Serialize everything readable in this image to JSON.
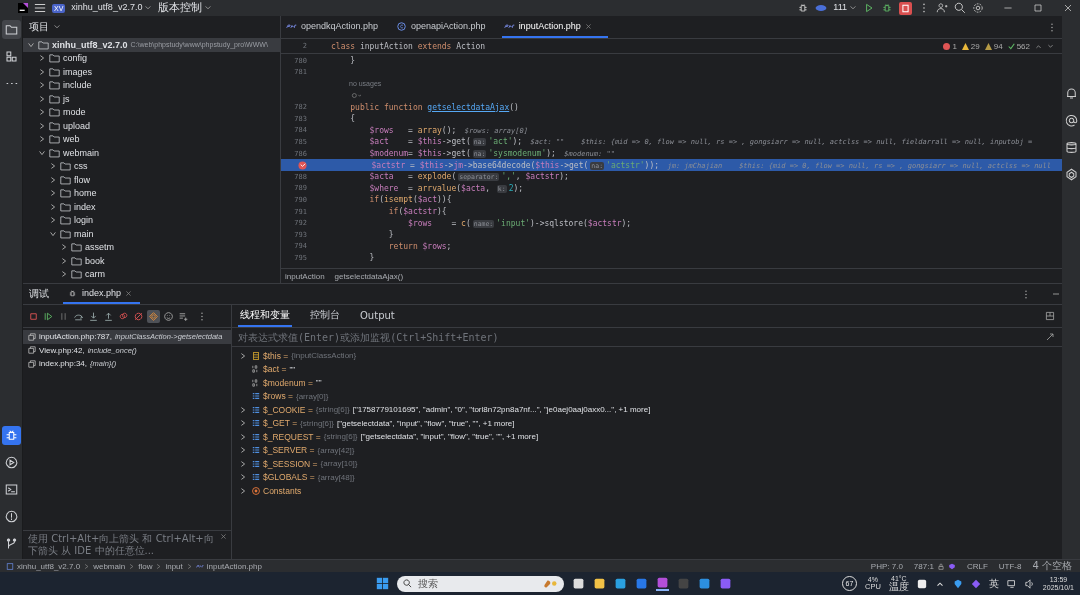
{
  "title_bar": {
    "project_badge": "XV",
    "project": "xinhu_utf8_v2.7.0",
    "vcs": "版本控制",
    "run_config": "111"
  },
  "left_strip": {
    "top": [
      {
        "kind": "folder",
        "selected": true
      },
      {
        "kind": "structure",
        "selected": false
      },
      {
        "kind": "more",
        "selected": false
      }
    ],
    "bottom": [
      {
        "kind": "debug",
        "selected": true
      },
      {
        "kind": "services",
        "selected": false
      },
      {
        "kind": "terminal",
        "selected": false
      },
      {
        "kind": "problems",
        "selected": false
      },
      {
        "kind": "git",
        "selected": false
      }
    ]
  },
  "project_panel": {
    "title": "项目",
    "tree": [
      {
        "name": "xinhu_utf8_v2.7.0",
        "path": "C:\\web\\phpstudy\\www\\phpstudy_pro\\WWW\\",
        "expanded": true,
        "selected": true,
        "children": [
          {
            "name": "config",
            "expanded": false,
            "selected": false
          },
          {
            "name": "images",
            "expanded": false,
            "selected": false
          },
          {
            "name": "include",
            "expanded": false,
            "selected": false
          },
          {
            "name": "js",
            "expanded": false,
            "selected": false
          },
          {
            "name": "mode",
            "expanded": false,
            "selected": false
          },
          {
            "name": "upload",
            "expanded": false,
            "selected": false
          },
          {
            "name": "web",
            "expanded": false,
            "selected": false
          },
          {
            "name": "webmain",
            "expanded": true,
            "selected": false,
            "children": [
              {
                "name": "css",
                "expanded": false,
                "selected": false
              },
              {
                "name": "flow",
                "expanded": false,
                "selected": false
              },
              {
                "name": "home",
                "expanded": false,
                "selected": false
              },
              {
                "name": "index",
                "expanded": false,
                "selected": false
              },
              {
                "name": "login",
                "expanded": false,
                "selected": false
              },
              {
                "name": "main",
                "expanded": true,
                "selected": false,
                "children": [
                  {
                    "name": "assetm",
                    "expanded": false,
                    "selected": false
                  },
                  {
                    "name": "book",
                    "expanded": false,
                    "selected": false
                  },
                  {
                    "name": "carm",
                    "expanded": false,
                    "selected": false
                  }
                ]
              }
            ]
          }
        ]
      }
    ]
  },
  "editor": {
    "tabs": [
      {
        "label": "opendkqAction.php",
        "kind": "php",
        "selected": false
      },
      {
        "label": "openapiAction.php",
        "kind": "class",
        "selected": false
      },
      {
        "label": "inputAction.php",
        "kind": "php",
        "selected": true
      }
    ],
    "inspections": {
      "errors": "1",
      "weak_warnings": "29",
      "warnings": "94",
      "ok": "562"
    },
    "sticky_line": {
      "number": "2",
      "segments": [
        {
          "kind": "kw",
          "text": "class"
        },
        {
          "kind": "plain",
          "text": " inputAction "
        },
        {
          "kind": "kw",
          "text": "extends"
        },
        {
          "kind": "plain",
          "text": " Action"
        }
      ]
    },
    "lines": [
      {
        "kind": "code",
        "number": "780",
        "breakpoint": false,
        "current": false,
        "segments": [
          {
            "kind": "plain",
            "text": "    }"
          }
        ]
      },
      {
        "kind": "code",
        "number": "781",
        "breakpoint": false,
        "current": false
      },
      {
        "kind": "lens",
        "text": "no usages"
      },
      {
        "kind": "code",
        "number": "782",
        "breakpoint": false,
        "current": false,
        "segments": [
          {
            "kind": "kw",
            "text": "    public "
          },
          {
            "kind": "kw",
            "text": "function "
          },
          {
            "kind": "fn",
            "text": "getselectdataAjax"
          },
          {
            "kind": "plain",
            "text": "()"
          }
        ]
      },
      {
        "kind": "code",
        "number": "783",
        "breakpoint": false,
        "current": false,
        "segments": [
          {
            "kind": "plain",
            "text": "    {"
          }
        ]
      },
      {
        "kind": "code",
        "number": "784",
        "breakpoint": false,
        "current": false,
        "segments": [
          {
            "kind": "var",
            "text": "        $rows"
          },
          {
            "kind": "plain",
            "text": "   = "
          },
          {
            "kind": "builtin",
            "text": "array"
          },
          {
            "kind": "plain",
            "text": "();"
          },
          {
            "kind": "hint",
            "text": "  $rows: array[0]"
          }
        ]
      },
      {
        "kind": "code",
        "number": "785",
        "breakpoint": false,
        "current": false,
        "segments": [
          {
            "kind": "var",
            "text": "        $act"
          },
          {
            "kind": "plain",
            "text": "    = "
          },
          {
            "kind": "var",
            "text": "$this"
          },
          {
            "kind": "plain",
            "text": "->get("
          },
          {
            "kind": "inlay",
            "text": "na:"
          },
          {
            "kind": "str",
            "text": "'act'"
          },
          {
            "kind": "plain",
            "text": ");"
          },
          {
            "kind": "hint",
            "text": "  $act: \"\"    $this: {mid => 0, flow => null, rs => , gongsiarr => null, actclss => null, fieldarrall => null, inputobj ="
          }
        ]
      },
      {
        "kind": "code",
        "number": "786",
        "breakpoint": false,
        "current": false,
        "segments": [
          {
            "kind": "var",
            "text": "        $modenum"
          },
          {
            "kind": "plain",
            "text": "= "
          },
          {
            "kind": "var",
            "text": "$this"
          },
          {
            "kind": "plain",
            "text": "->get("
          },
          {
            "kind": "inlay",
            "text": "na:"
          },
          {
            "kind": "str",
            "text": "'sysmodenum'"
          },
          {
            "kind": "plain",
            "text": ");"
          },
          {
            "kind": "hint",
            "text": "  $modenum: \"\""
          }
        ]
      },
      {
        "kind": "code",
        "breakpoint": true,
        "current": true,
        "segments": [
          {
            "kind": "var",
            "text": "        $actstr"
          },
          {
            "kind": "plain",
            "text": " = "
          },
          {
            "kind": "var",
            "text": "$this"
          },
          {
            "kind": "plain",
            "text": "->"
          },
          {
            "kind": "var",
            "text": "jm"
          },
          {
            "kind": "plain",
            "text": "->base64decode("
          },
          {
            "kind": "var",
            "text": "$this"
          },
          {
            "kind": "plain",
            "text": "->get("
          },
          {
            "kind": "inlay",
            "text": "na:"
          },
          {
            "kind": "str",
            "text": "'actstr'"
          },
          {
            "kind": "plain",
            "text": "));"
          },
          {
            "kind": "hint",
            "text": "  jm: jmChajian    $this: {mid => 0, flow => null, rs => , gongsiarr => null, actclss => null"
          }
        ]
      },
      {
        "kind": "code",
        "number": "788",
        "breakpoint": false,
        "current": false,
        "segments": [
          {
            "kind": "var",
            "text": "        $acta"
          },
          {
            "kind": "plain",
            "text": "   = "
          },
          {
            "kind": "builtin",
            "text": "explode"
          },
          {
            "kind": "plain",
            "text": "("
          },
          {
            "kind": "inlay",
            "text": "separator:"
          },
          {
            "kind": "str",
            "text": "','"
          },
          {
            "kind": "plain",
            "text": ", "
          },
          {
            "kind": "var",
            "text": "$actstr"
          },
          {
            "kind": "plain",
            "text": ");"
          }
        ]
      },
      {
        "kind": "code",
        "number": "789",
        "breakpoint": false,
        "current": false,
        "segments": [
          {
            "kind": "var",
            "text": "        $where"
          },
          {
            "kind": "plain",
            "text": "  = "
          },
          {
            "kind": "builtin",
            "text": "arrvalue"
          },
          {
            "kind": "plain",
            "text": "("
          },
          {
            "kind": "var",
            "text": "$acta"
          },
          {
            "kind": "plain",
            "text": ", "
          },
          {
            "kind": "inlay",
            "text": "k:"
          },
          {
            "kind": "num",
            "text": "2"
          },
          {
            "kind": "plain",
            "text": ");"
          }
        ]
      },
      {
        "kind": "code",
        "number": "790",
        "breakpoint": false,
        "current": false,
        "segments": [
          {
            "kind": "kw",
            "text": "        if"
          },
          {
            "kind": "plain",
            "text": "("
          },
          {
            "kind": "builtin",
            "text": "isempt"
          },
          {
            "kind": "plain",
            "text": "("
          },
          {
            "kind": "var",
            "text": "$act"
          },
          {
            "kind": "plain",
            "text": ")){"
          }
        ]
      },
      {
        "kind": "code",
        "number": "791",
        "breakpoint": false,
        "current": false,
        "segments": [
          {
            "kind": "kw",
            "text": "            if"
          },
          {
            "kind": "plain",
            "text": "("
          },
          {
            "kind": "var",
            "text": "$actstr"
          },
          {
            "kind": "plain",
            "text": "){"
          }
        ]
      },
      {
        "kind": "code",
        "number": "792",
        "breakpoint": false,
        "current": false,
        "segments": [
          {
            "kind": "var",
            "text": "                $rows"
          },
          {
            "kind": "plain",
            "text": "    = "
          },
          {
            "kind": "builtin",
            "text": "c"
          },
          {
            "kind": "plain",
            "text": "("
          },
          {
            "kind": "inlay",
            "text": "name:"
          },
          {
            "kind": "str",
            "text": "'input'"
          },
          {
            "kind": "plain",
            "text": ")->sqlstore("
          },
          {
            "kind": "var",
            "text": "$actstr"
          },
          {
            "kind": "plain",
            "text": ");"
          }
        ]
      },
      {
        "kind": "code",
        "number": "793",
        "breakpoint": false,
        "current": false,
        "segments": [
          {
            "kind": "plain",
            "text": "            }"
          }
        ]
      },
      {
        "kind": "code",
        "number": "794",
        "breakpoint": false,
        "current": false,
        "segments": [
          {
            "kind": "kw",
            "text": "            return "
          },
          {
            "kind": "var",
            "text": "$rows"
          },
          {
            "kind": "plain",
            "text": ";"
          }
        ]
      },
      {
        "kind": "code",
        "number": "795",
        "breakpoint": false,
        "current": false,
        "segments": [
          {
            "kind": "plain",
            "text": "        }"
          }
        ]
      }
    ],
    "breadcrumb": [
      "inputAction",
      "getselectdataAjax()"
    ]
  },
  "debug_panel": {
    "title": "调试",
    "session": "index.php",
    "toolbar": [
      {
        "kind": "stop",
        "selected": false
      },
      {
        "kind": "resume",
        "selected": false
      },
      {
        "kind": "pause",
        "selected": false
      },
      {
        "kind": "step-over",
        "selected": false
      },
      {
        "kind": "step-into",
        "selected": false
      },
      {
        "kind": "step-out",
        "selected": false
      },
      {
        "kind": "breakpoints",
        "selected": false
      },
      {
        "kind": "mute",
        "selected": false
      },
      {
        "kind": "break-first",
        "selected": true
      },
      {
        "kind": "smiley",
        "selected": false
      },
      {
        "kind": "watch",
        "selected": false
      }
    ],
    "frames": [
      {
        "file": "inputAction.php:787,",
        "call": "inputClassAction->getselectdata",
        "selected": true
      },
      {
        "file": "View.php:42,",
        "call": "include_once()",
        "selected": false
      },
      {
        "file": "index.php:34,",
        "call": "{main}()",
        "selected": false
      }
    ],
    "hint": "使用 Ctrl+Alt+向上箭头 和 Ctrl+Alt+向下箭头 从 IDE 中的任意位...",
    "tabs": [
      {
        "label": "线程和变量",
        "selected": true
      },
      {
        "label": "控制台",
        "selected": false
      },
      {
        "label": "Output",
        "selected": false
      }
    ],
    "eval_placeholder": "对表达式求值(Enter)或添加监视(Ctrl+Shift+Enter)",
    "variables": [
      {
        "kind": "object",
        "name": "$this =",
        "type": "{inputClassAction}",
        "expandable": true
      },
      {
        "kind": "scalar",
        "name": "$act =",
        "value": "\"\"",
        "expandable": false
      },
      {
        "kind": "scalar",
        "name": "$modenum =",
        "value": "\"\"",
        "expandable": false
      },
      {
        "kind": "array",
        "name": "$rows =",
        "type": "{array[0]}",
        "expandable": false
      },
      {
        "kind": "array",
        "name": "$_COOKIE =",
        "type": "{string[6]}",
        "value": "[\"1758779101695\", \"admin\", \"0\", \"torl8n72pn8a7nf...\", \"je0aej0aaj0axx0...\", +1 more]",
        "expandable": true
      },
      {
        "kind": "array",
        "name": "$_GET =",
        "type": "{string[6]}",
        "value": "[\"getselectdata\", \"input\", \"flow\", \"true\", \"\", +1 more]",
        "expandable": true
      },
      {
        "kind": "array",
        "name": "$_REQUEST =",
        "type": "{string[6]}",
        "value": "[\"getselectdata\", \"input\", \"flow\", \"true\", \"\", +1 more]",
        "expandable": true
      },
      {
        "kind": "array",
        "name": "$_SERVER =",
        "type": "{array[42]}",
        "expandable": true
      },
      {
        "kind": "array",
        "name": "$_SESSION =",
        "type": "{array[10]}",
        "expandable": true
      },
      {
        "kind": "array",
        "name": "$GLOBALS =",
        "type": "{array[48]}",
        "expandable": true
      },
      {
        "kind": "constants",
        "name": "Constants",
        "expandable": true
      }
    ]
  },
  "status_bar": {
    "path": [
      "xinhu_utf8_v2.7.0",
      "webmain",
      "flow",
      "input",
      "inputAction.php"
    ],
    "php": "PHP: 7.0",
    "position": "787:1",
    "line_ending": "CRLF",
    "encoding": "UTF-8",
    "indent": "4 个空格"
  },
  "taskbar": {
    "search": "搜索",
    "apps": [
      {
        "kind": "task-view",
        "selected": false
      },
      {
        "kind": "explorer",
        "selected": false
      },
      {
        "kind": "edge",
        "selected": false
      },
      {
        "kind": "p-app",
        "selected": false
      },
      {
        "kind": "phpstorm",
        "selected": true
      },
      {
        "kind": "terminal",
        "selected": false
      },
      {
        "kind": "vscode",
        "selected": false
      },
      {
        "kind": "bolt",
        "selected": false
      }
    ],
    "badge": "67",
    "cpu": "4%",
    "cpu_label": "CPU",
    "temp": "41°C",
    "temp_label": "温度",
    "ime": "英",
    "time": "13:59",
    "date": "2025/10/1"
  }
}
